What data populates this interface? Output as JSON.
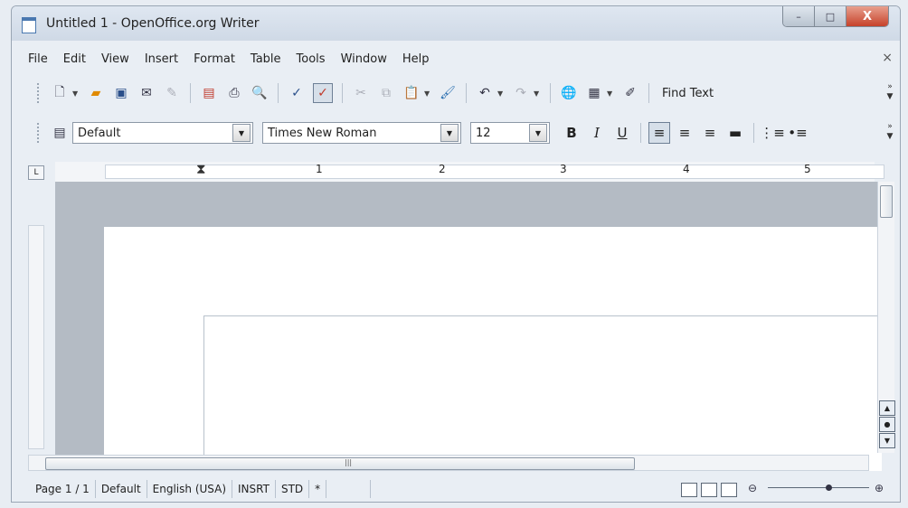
{
  "window": {
    "title": "Untitled 1 - OpenOffice.org Writer",
    "buttons": {
      "minimize": "–",
      "maximize": "□",
      "close": "X"
    }
  },
  "menu": {
    "items": [
      "File",
      "Edit",
      "View",
      "Insert",
      "Format",
      "Table",
      "Tools",
      "Window",
      "Help"
    ],
    "close": "×"
  },
  "standard_toolbar": {
    "find_text": "Find Text",
    "chevron": "»"
  },
  "formatting_toolbar": {
    "paragraph_style": "Default",
    "font_name": "Times New Roman",
    "font_size": "12",
    "bold": "B",
    "italic": "I",
    "underline": "U"
  },
  "ruler": {
    "numbers": [
      "1",
      "2",
      "3",
      "4",
      "5"
    ],
    "corner": "L"
  },
  "status": {
    "page": "Page 1 / 1",
    "style": "Default",
    "language": "English (USA)",
    "insert_mode": "INSRT",
    "selection_mode": "STD",
    "modified": "*"
  },
  "zoom": {
    "minus": "⊖",
    "plus": "⊕"
  }
}
